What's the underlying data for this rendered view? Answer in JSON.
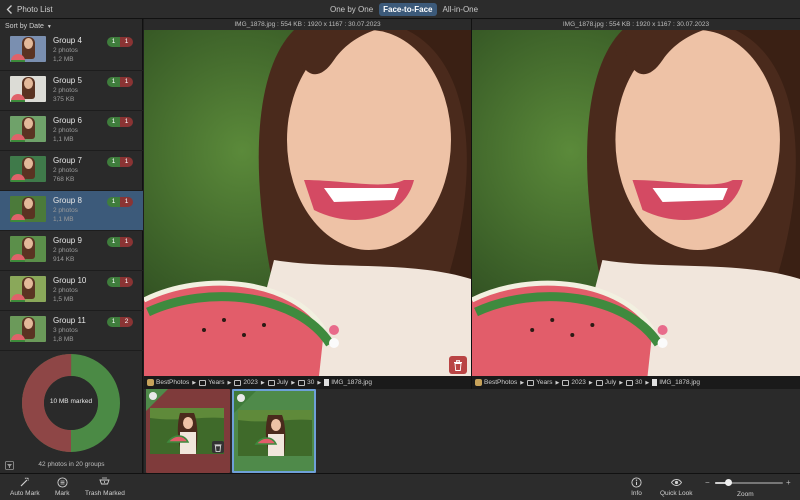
{
  "header": {
    "back_label": "Photo List",
    "modes": [
      "One by One",
      "Face-to-Face",
      "All-in-One"
    ],
    "active_mode": "Face-to-Face"
  },
  "sidebar": {
    "sort_label": "Sort by Date",
    "groups": [
      {
        "name": "Group 4",
        "count": "2 photos",
        "size": "1,2 MB",
        "keep": "1",
        "trash": "1",
        "thumb_color": "#7a8fb0"
      },
      {
        "name": "Group 5",
        "count": "2 photos",
        "size": "375 KB",
        "keep": "1",
        "trash": "1",
        "thumb_color": "#dcdcd6"
      },
      {
        "name": "Group 6",
        "count": "2 photos",
        "size": "1,1 MB",
        "keep": "1",
        "trash": "1",
        "thumb_color": "#6fa26a"
      },
      {
        "name": "Group 7",
        "count": "2 photos",
        "size": "768 KB",
        "keep": "1",
        "trash": "1",
        "thumb_color": "#3f7a4a"
      },
      {
        "name": "Group 8",
        "count": "2 photos",
        "size": "1,1 MB",
        "keep": "1",
        "trash": "1",
        "thumb_color": "#4b7a3a"
      },
      {
        "name": "Group 9",
        "count": "2 photos",
        "size": "914 KB",
        "keep": "1",
        "trash": "1",
        "thumb_color": "#5b8f4a"
      },
      {
        "name": "Group 10",
        "count": "2 photos",
        "size": "1,5 MB",
        "keep": "1",
        "trash": "1",
        "thumb_color": "#8aa85a"
      },
      {
        "name": "Group 11",
        "count": "3 photos",
        "size": "1,8 MB",
        "keep": "1",
        "trash": "2",
        "thumb_color": "#6b9a5a"
      }
    ],
    "selected_group": "Group 8",
    "marked_label": "10 MB marked",
    "marked_fraction": 0.5,
    "stat": "42 photos in 20 groups"
  },
  "compare": {
    "left_info": "IMG_1878.jpg : 554 KB : 1920 x 1167 : 30.07.2023",
    "right_info": "IMG_1878.jpg : 554 KB : 1920 x 1167 : 30.07.2023",
    "path": [
      "BestPhotos",
      "Years",
      "2023",
      "July",
      "30",
      "IMG_1878.jpg"
    ]
  },
  "toolbar": {
    "auto_mark": "Auto Mark",
    "mark": "Mark",
    "trash_marked": "Trash Marked",
    "info": "Info",
    "quick_look": "Quick Look",
    "zoom": "Zoom",
    "zoom_level": 0.2
  },
  "colors": {
    "accent": "#3c5a7a",
    "keep_green": "#3f7d3c",
    "trash_red": "#8a3434",
    "donut_green": "#4b8a45",
    "donut_red": "#8e4646"
  }
}
